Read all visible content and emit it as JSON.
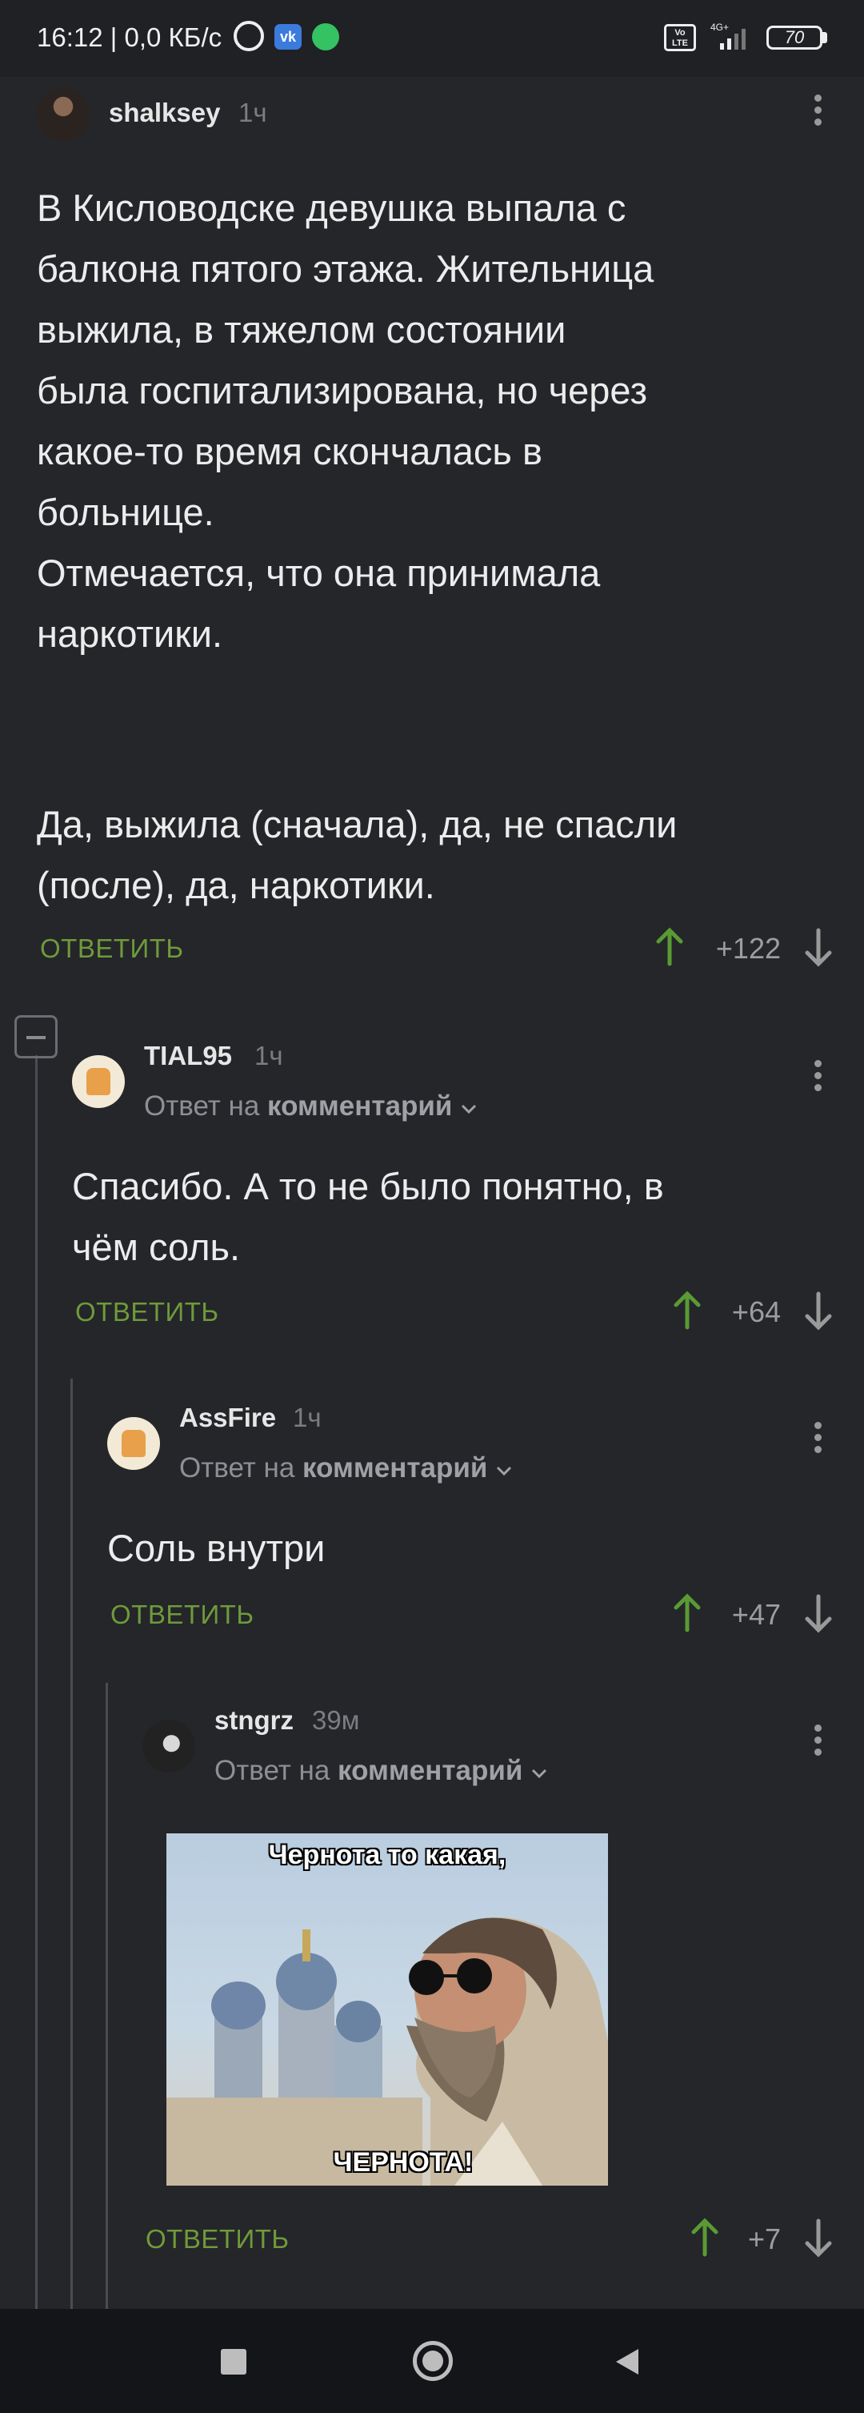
{
  "status": {
    "time": "16:12",
    "speed": "0,0 КБ/с",
    "network": "4G+",
    "volte": "Vo LTE",
    "battery": "70"
  },
  "post": {
    "author": "shalksey",
    "time": "1ч",
    "text": "В Кисловодске девушка выпала с\nбалкона пятого этажа. Жительница\nвыжила, в тяжелом состоянии\nбыла госпитализирована, но через\nкакое-то время скончалась в\nбольнице.\nОтмечается, что она принимала\nнаркотики.",
    "text2": "Да, выжила (сначала), да, не спасли\n(после), да, наркотики.",
    "reply_label": "ОТВЕТИТЬ",
    "score": "+122"
  },
  "comments": [
    {
      "author": "TIAL95",
      "time": "1ч",
      "reply_prefix": "Ответ на",
      "reply_target": "комментарий",
      "text": "Спасибо. А то не было понятно, в\nчём соль.",
      "reply_label": "ОТВЕТИТЬ",
      "score": "+64"
    },
    {
      "author": "AssFire",
      "time": "1ч",
      "reply_prefix": "Ответ на",
      "reply_target": "комментарий",
      "text": "Соль внутри",
      "reply_label": "ОТВЕТИТЬ",
      "score": "+47"
    },
    {
      "author": "stngrz",
      "time": "39м",
      "reply_prefix": "Ответ на",
      "reply_target": "комментарий",
      "image_caption_top": "Чернота то какая,",
      "image_caption_bottom": "ЧЕРНОТА!",
      "reply_label": "ОТВЕТИТЬ",
      "score": "+7"
    }
  ],
  "colors": {
    "background": "#24262a",
    "reply_green": "#6f9a3a",
    "upvote_green": "#5a9a34",
    "muted": "#8d8f94"
  },
  "icons": [
    "alarm-icon",
    "vk-icon",
    "whatsapp-icon",
    "signal-icon",
    "battery-icon",
    "more-vert-icon",
    "upvote-icon",
    "downvote-icon",
    "collapse-icon",
    "chevron-down-icon",
    "nav-recents-icon",
    "nav-home-icon",
    "nav-back-icon"
  ]
}
